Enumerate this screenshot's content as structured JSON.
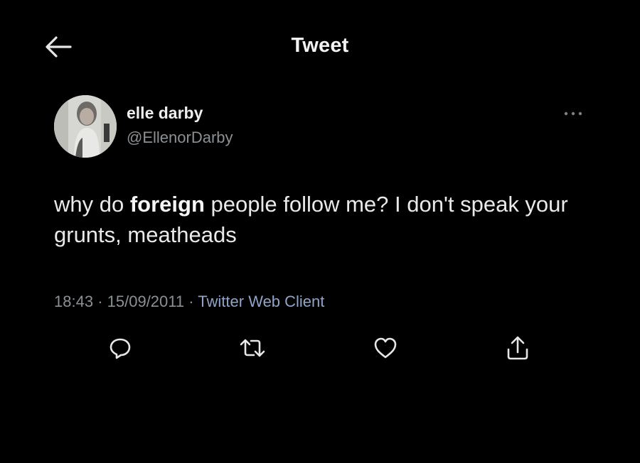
{
  "header": {
    "title": "Tweet",
    "back_icon": "arrow-left-icon"
  },
  "tweet": {
    "author": {
      "name": "elle darby",
      "handle": "@EllenorDarby"
    },
    "text": {
      "part1": "why do ",
      "bold": "foreign",
      "part2": " people follow me? I don't speak your grunts, meatheads"
    },
    "time": "18:43",
    "date": "15/09/2011",
    "separator": "·",
    "client": "Twitter Web Client"
  },
  "actions": [
    {
      "name": "reply",
      "icon": "reply-icon"
    },
    {
      "name": "retweet",
      "icon": "retweet-icon"
    },
    {
      "name": "like",
      "icon": "heart-icon"
    },
    {
      "name": "share",
      "icon": "share-icon"
    }
  ],
  "colors": {
    "background": "#000000",
    "text": "#e9e9e9",
    "secondary": "#8b9094",
    "link": "#8fa4c6"
  }
}
